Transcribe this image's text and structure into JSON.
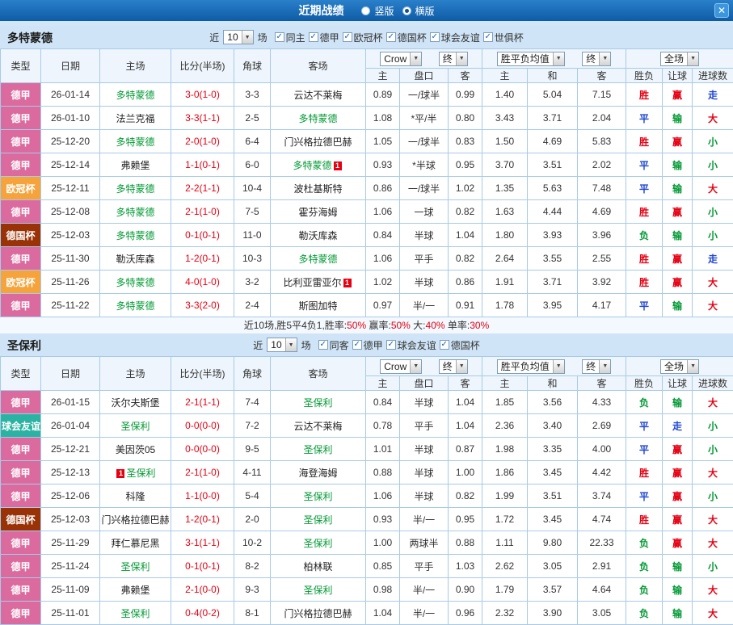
{
  "titlebar": {
    "title": "近期战绩",
    "radio_vertical": "竖版",
    "radio_horizontal": "横版",
    "selected": "横版",
    "close": "✕"
  },
  "colors": {
    "league": {
      "德甲": "#db6b9e",
      "欧冠杯": "#f6a33b",
      "德国杯": "#993307",
      "球会友谊": "#2ab3a2"
    },
    "result": {
      "胜": "#e60012",
      "平": "#1f46d2",
      "负": "#009933",
      "赢": "#e60012",
      "输": "#009933",
      "走": "#1f46d2",
      "大": "#e60012",
      "小": "#009933"
    },
    "team_self": "#009933",
    "score": "#e60012"
  },
  "table_headers": {
    "type": "类型",
    "date": "日期",
    "home": "主场",
    "score": "比分(半场)",
    "corner": "角球",
    "away": "客场",
    "odds_home": "主",
    "odds_line": "盘口",
    "odds_away": "客",
    "mean_home": "主",
    "mean_draw": "和",
    "mean_away": "客",
    "wdl": "胜负",
    "handicap": "让球",
    "goals": "进球数",
    "dd_crow": "Crow",
    "dd_final1": "终",
    "dd_mean": "胜平负均值",
    "dd_final2": "终",
    "dd_fullmatch": "全场"
  },
  "sections": [
    {
      "team": "多特蒙德",
      "filter": {
        "prefix": "近",
        "count": "10",
        "suffix": "场",
        "checks": [
          "同主",
          "德甲",
          "欧冠杯",
          "德国杯",
          "球会友谊",
          "世俱杯"
        ]
      },
      "rows": [
        {
          "type": "德甲",
          "date": "26-01-14",
          "home": "多特蒙德",
          "home_self": true,
          "score": "3-0(1-0)",
          "corner": "3-3",
          "away": "云达不莱梅",
          "odds": [
            "0.89",
            "一/球半",
            "0.99"
          ],
          "mean": [
            "1.40",
            "5.04",
            "7.15"
          ],
          "wdl": "胜",
          "hcp": "赢",
          "goals": "走"
        },
        {
          "type": "德甲",
          "date": "26-01-10",
          "home": "法兰克福",
          "score": "3-3(1-1)",
          "corner": "2-5",
          "away": "多特蒙德",
          "away_self": true,
          "odds": [
            "1.08",
            "*平/半",
            "0.80"
          ],
          "mean": [
            "3.43",
            "3.71",
            "2.04"
          ],
          "wdl": "平",
          "hcp": "输",
          "goals": "大"
        },
        {
          "type": "德甲",
          "date": "25-12-20",
          "home": "多特蒙德",
          "home_self": true,
          "score": "2-0(1-0)",
          "corner": "6-4",
          "away": "门兴格拉德巴赫",
          "odds": [
            "1.05",
            "一/球半",
            "0.83"
          ],
          "mean": [
            "1.50",
            "4.69",
            "5.83"
          ],
          "wdl": "胜",
          "hcp": "赢",
          "goals": "小"
        },
        {
          "type": "德甲",
          "date": "25-12-14",
          "home": "弗赖堡",
          "score": "1-1(0-1)",
          "corner": "6-0",
          "away": "多特蒙德",
          "away_self": true,
          "away_badge": "1",
          "away_badge_pos": "after",
          "odds": [
            "0.93",
            "*半球",
            "0.95"
          ],
          "mean": [
            "3.70",
            "3.51",
            "2.02"
          ],
          "wdl": "平",
          "hcp": "输",
          "goals": "小"
        },
        {
          "type": "欧冠杯",
          "date": "25-12-11",
          "home": "多特蒙德",
          "home_self": true,
          "score": "2-2(1-1)",
          "corner": "10-4",
          "away": "波杜基斯特",
          "odds": [
            "0.86",
            "一/球半",
            "1.02"
          ],
          "mean": [
            "1.35",
            "5.63",
            "7.48"
          ],
          "wdl": "平",
          "hcp": "输",
          "goals": "大"
        },
        {
          "type": "德甲",
          "date": "25-12-08",
          "home": "多特蒙德",
          "home_self": true,
          "score": "2-1(1-0)",
          "corner": "7-5",
          "away": "霍芬海姆",
          "odds": [
            "1.06",
            "一球",
            "0.82"
          ],
          "mean": [
            "1.63",
            "4.44",
            "4.69"
          ],
          "wdl": "胜",
          "hcp": "赢",
          "goals": "小"
        },
        {
          "type": "德国杯",
          "date": "25-12-03",
          "home": "多特蒙德",
          "home_self": true,
          "score": "0-1(0-1)",
          "corner": "11-0",
          "away": "勒沃库森",
          "odds": [
            "0.84",
            "半球",
            "1.04"
          ],
          "mean": [
            "1.80",
            "3.93",
            "3.96"
          ],
          "wdl": "负",
          "hcp": "输",
          "goals": "小"
        },
        {
          "type": "德甲",
          "date": "25-11-30",
          "home": "勒沃库森",
          "score": "1-2(0-1)",
          "corner": "10-3",
          "away": "多特蒙德",
          "away_self": true,
          "odds": [
            "1.06",
            "平手",
            "0.82"
          ],
          "mean": [
            "2.64",
            "3.55",
            "2.55"
          ],
          "wdl": "胜",
          "hcp": "赢",
          "goals": "走"
        },
        {
          "type": "欧冠杯",
          "date": "25-11-26",
          "home": "多特蒙德",
          "home_self": true,
          "score": "4-0(1-0)",
          "corner": "3-2",
          "away": "比利亚雷亚尔",
          "away_badge": "1",
          "away_badge_pos": "after",
          "odds": [
            "1.02",
            "半球",
            "0.86"
          ],
          "mean": [
            "1.91",
            "3.71",
            "3.92"
          ],
          "wdl": "胜",
          "hcp": "赢",
          "goals": "大"
        },
        {
          "type": "德甲",
          "date": "25-11-22",
          "home": "多特蒙德",
          "home_self": true,
          "score": "3-3(2-0)",
          "corner": "2-4",
          "away": "斯图加特",
          "odds": [
            "0.97",
            "半/一",
            "0.91"
          ],
          "mean": [
            "1.78",
            "3.95",
            "4.17"
          ],
          "wdl": "平",
          "hcp": "输",
          "goals": "大"
        }
      ],
      "summary_parts": [
        {
          "text": "近10场,胜5平4负1,胜率:",
          "color": "#333333"
        },
        {
          "text": "50%",
          "color": "#e60012"
        },
        {
          "text": " 赢率:",
          "color": "#333333"
        },
        {
          "text": "50%",
          "color": "#e60012"
        },
        {
          "text": " 大:",
          "color": "#333333"
        },
        {
          "text": "40%",
          "color": "#e60012"
        },
        {
          "text": " 单率:",
          "color": "#333333"
        },
        {
          "text": "30%",
          "color": "#e60012"
        }
      ]
    },
    {
      "team": "圣保利",
      "filter": {
        "prefix": "近",
        "count": "10",
        "suffix": "场",
        "checks": [
          "同客",
          "德甲",
          "球会友谊",
          "德国杯"
        ]
      },
      "rows": [
        {
          "type": "德甲",
          "date": "26-01-15",
          "home": "沃尔夫斯堡",
          "score": "2-1(1-1)",
          "corner": "7-4",
          "away": "圣保利",
          "away_self": true,
          "odds": [
            "0.84",
            "半球",
            "1.04"
          ],
          "mean": [
            "1.85",
            "3.56",
            "4.33"
          ],
          "wdl": "负",
          "hcp": "输",
          "goals": "大"
        },
        {
          "type": "球会友谊",
          "date": "26-01-04",
          "home": "圣保利",
          "home_self": true,
          "score": "0-0(0-0)",
          "corner": "7-2",
          "away": "云达不莱梅",
          "odds": [
            "0.78",
            "平手",
            "1.04"
          ],
          "mean": [
            "2.36",
            "3.40",
            "2.69"
          ],
          "wdl": "平",
          "hcp": "走",
          "goals": "小"
        },
        {
          "type": "德甲",
          "date": "25-12-21",
          "home": "美因茨05",
          "score": "0-0(0-0)",
          "corner": "9-5",
          "away": "圣保利",
          "away_self": true,
          "odds": [
            "1.01",
            "半球",
            "0.87"
          ],
          "mean": [
            "1.98",
            "3.35",
            "4.00"
          ],
          "wdl": "平",
          "hcp": "赢",
          "goals": "小"
        },
        {
          "type": "德甲",
          "date": "25-12-13",
          "home": "圣保利",
          "home_self": true,
          "home_badge": "1",
          "home_badge_pos": "before",
          "score": "2-1(1-0)",
          "corner": "4-11",
          "away": "海登海姆",
          "odds": [
            "0.88",
            "半球",
            "1.00"
          ],
          "mean": [
            "1.86",
            "3.45",
            "4.42"
          ],
          "wdl": "胜",
          "hcp": "赢",
          "goals": "大"
        },
        {
          "type": "德甲",
          "date": "25-12-06",
          "home": "科隆",
          "score": "1-1(0-0)",
          "corner": "5-4",
          "away": "圣保利",
          "away_self": true,
          "odds": [
            "1.06",
            "半球",
            "0.82"
          ],
          "mean": [
            "1.99",
            "3.51",
            "3.74"
          ],
          "wdl": "平",
          "hcp": "赢",
          "goals": "小"
        },
        {
          "type": "德国杯",
          "date": "25-12-03",
          "home": "门兴格拉德巴赫",
          "score": "1-2(0-1)",
          "corner": "2-0",
          "away": "圣保利",
          "away_self": true,
          "odds": [
            "0.93",
            "半/一",
            "0.95"
          ],
          "mean": [
            "1.72",
            "3.45",
            "4.74"
          ],
          "wdl": "胜",
          "hcp": "赢",
          "goals": "大"
        },
        {
          "type": "德甲",
          "date": "25-11-29",
          "home": "拜仁慕尼黑",
          "score": "3-1(1-1)",
          "corner": "10-2",
          "away": "圣保利",
          "away_self": true,
          "odds": [
            "1.00",
            "两球半",
            "0.88"
          ],
          "mean": [
            "1.11",
            "9.80",
            "22.33"
          ],
          "wdl": "负",
          "hcp": "赢",
          "goals": "大"
        },
        {
          "type": "德甲",
          "date": "25-11-24",
          "home": "圣保利",
          "home_self": true,
          "score": "0-1(0-1)",
          "corner": "8-2",
          "away": "柏林联",
          "odds": [
            "0.85",
            "平手",
            "1.03"
          ],
          "mean": [
            "2.62",
            "3.05",
            "2.91"
          ],
          "wdl": "负",
          "hcp": "输",
          "goals": "小"
        },
        {
          "type": "德甲",
          "date": "25-11-09",
          "home": "弗赖堡",
          "score": "2-1(0-0)",
          "corner": "9-3",
          "away": "圣保利",
          "away_self": true,
          "odds": [
            "0.98",
            "半/一",
            "0.90"
          ],
          "mean": [
            "1.79",
            "3.57",
            "4.64"
          ],
          "wdl": "负",
          "hcp": "输",
          "goals": "大"
        },
        {
          "type": "德甲",
          "date": "25-11-01",
          "home": "圣保利",
          "home_self": true,
          "score": "0-4(0-2)",
          "corner": "8-1",
          "away": "门兴格拉德巴赫",
          "odds": [
            "1.04",
            "半/一",
            "0.96"
          ],
          "mean": [
            "2.32",
            "3.90",
            "3.05"
          ],
          "wdl": "负",
          "hcp": "输",
          "goals": "大"
        }
      ],
      "summary_parts": []
    }
  ]
}
